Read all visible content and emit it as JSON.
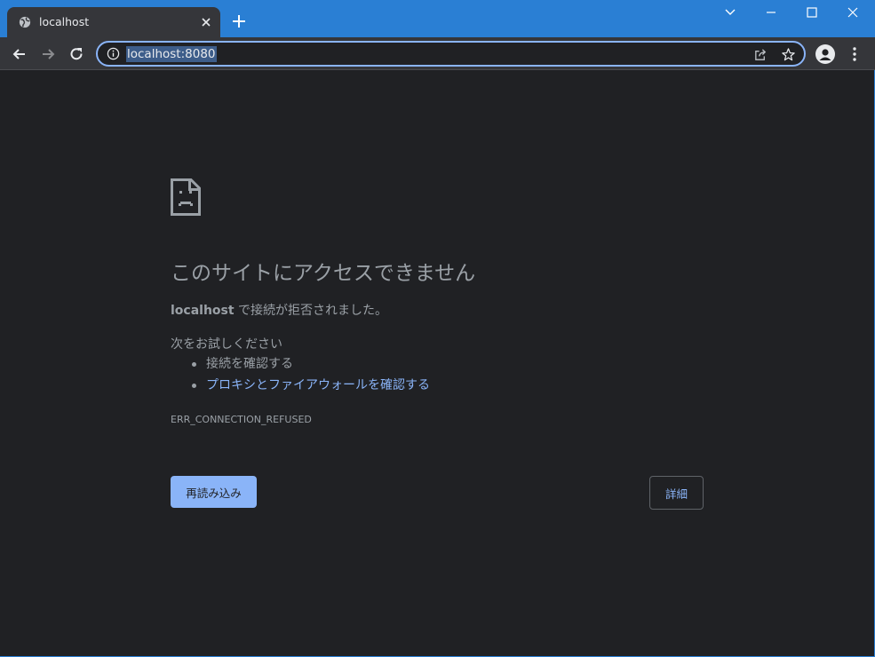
{
  "tab": {
    "title": "localhost"
  },
  "omnibox": {
    "url": "localhost:8080"
  },
  "error": {
    "title": "このサイトにアクセスできません",
    "host": "localhost",
    "description_suffix": " で接続が拒否されました。",
    "try_heading": "次をお試しください",
    "suggestions": [
      "接続を確認する",
      "プロキシとファイアウォールを確認する"
    ],
    "code": "ERR_CONNECTION_REFUSED"
  },
  "buttons": {
    "reload": "再読み込み",
    "details": "詳細"
  },
  "colors": {
    "titlebar": "#2a7fd4",
    "accent": "#8ab4f8",
    "background": "#202124",
    "text": "#9aa0a6"
  }
}
